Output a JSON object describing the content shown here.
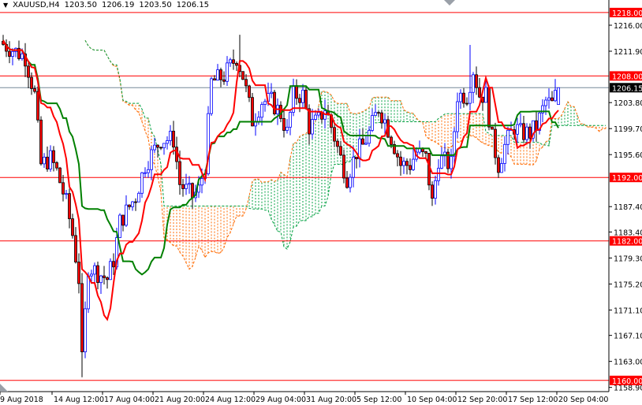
{
  "header": {
    "symbol": "XAUUSD,H4",
    "open": "1203.50",
    "high": "1206.19",
    "low": "1203.50",
    "close": "1206.15"
  },
  "colors": {
    "bull": "#0000ff",
    "bear": "#ff0000",
    "tenkan": "#ff0000",
    "kijun": "#008000",
    "cloud_bear": "#ff6a00",
    "cloud_bull": "#00a040",
    "level": "#ff0000",
    "price_line": "#778899"
  },
  "chart_data": {
    "type": "candlestick",
    "title": "XAUUSD,H4",
    "indicator": "Ichimoku Kinko Hyo (tenkan 9, kijun 26, senkou B 52)",
    "ylim": [
      1158.9,
      1218.0
    ],
    "y_ticks": [
      "1216.00",
      "1211.90",
      "1203.80",
      "1199.70",
      "1195.60",
      "1187.40",
      "1183.40",
      "1179.30",
      "1175.20",
      "1171.10",
      "1167.10",
      "1163.00",
      "1158.90"
    ],
    "y_tick_values": [
      1216.0,
      1211.9,
      1203.8,
      1199.7,
      1195.6,
      1187.4,
      1183.4,
      1179.3,
      1175.2,
      1171.1,
      1167.1,
      1163.0,
      1158.9
    ],
    "x_ticks": [
      "9 Aug 2018",
      "14 Aug 12:00",
      "17 Aug 04:00",
      "21 Aug 20:00",
      "24 Aug 12:00",
      "29 Aug 04:00",
      "31 Aug 20:00",
      "5 Sep 12:00",
      "10 Sep 04:00",
      "12 Sep 20:00",
      "17 Sep 12:00",
      "20 Sep 04:00"
    ],
    "bars_per_x_tick": 16,
    "levels": [
      {
        "value": 1218.0,
        "label": "1218.00"
      },
      {
        "value": 1208.0,
        "label": "1208.00"
      },
      {
        "value": 1192.0,
        "label": "1192.00"
      },
      {
        "value": 1182.0,
        "label": "1182.00"
      },
      {
        "value": 1160.0,
        "label": "1160.00"
      }
    ],
    "current_price": {
      "value": 1206.15,
      "label": "1206.15"
    },
    "close_path": [
      [
        0,
        1213
      ],
      [
        7,
        1211
      ],
      [
        10,
        1205
      ],
      [
        12,
        1194
      ],
      [
        15,
        1195
      ],
      [
        17,
        1193
      ],
      [
        20,
        1188
      ],
      [
        22,
        1183
      ],
      [
        24,
        1176
      ],
      [
        25,
        1163
      ],
      [
        27,
        1178
      ],
      [
        30,
        1177
      ],
      [
        33,
        1176
      ],
      [
        35,
        1179
      ],
      [
        37,
        1185
      ],
      [
        42,
        1189
      ],
      [
        45,
        1194
      ],
      [
        50,
        1198
      ],
      [
        54,
        1198
      ],
      [
        56,
        1191
      ],
      [
        60,
        1189
      ],
      [
        62,
        1190
      ],
      [
        64,
        1194
      ],
      [
        66,
        1207
      ],
      [
        70,
        1208
      ],
      [
        74,
        1211
      ],
      [
        76,
        1208
      ],
      [
        79,
        1201
      ],
      [
        82,
        1204
      ],
      [
        85,
        1204
      ],
      [
        88,
        1202
      ],
      [
        90,
        1199
      ],
      [
        92,
        1205
      ],
      [
        95,
        1205
      ],
      [
        97,
        1200
      ],
      [
        100,
        1201
      ],
      [
        102,
        1203
      ],
      [
        104,
        1200
      ],
      [
        107,
        1195
      ],
      [
        109,
        1192
      ],
      [
        112,
        1196
      ],
      [
        114,
        1197
      ],
      [
        116,
        1199
      ],
      [
        119,
        1203
      ],
      [
        121,
        1201
      ],
      [
        124,
        1197
      ],
      [
        126,
        1194
      ],
      [
        129,
        1194
      ],
      [
        131,
        1196
      ],
      [
        134,
        1195
      ],
      [
        136,
        1188
      ],
      [
        138,
        1195
      ],
      [
        142,
        1194
      ],
      [
        144,
        1205
      ],
      [
        147,
        1205
      ],
      [
        149,
        1209
      ],
      [
        151,
        1205
      ],
      [
        153,
        1205
      ],
      [
        155,
        1198
      ],
      [
        157,
        1194
      ],
      [
        159,
        1197
      ],
      [
        162,
        1200
      ],
      [
        164,
        1199
      ],
      [
        167,
        1199
      ],
      [
        169,
        1200
      ],
      [
        172,
        1204
      ],
      [
        174,
        1203.5
      ],
      [
        176,
        1206.15
      ]
    ],
    "spikes": [
      {
        "bar": 25,
        "low": 1160.5
      },
      {
        "bar": 75,
        "high": 1214.5
      },
      {
        "bar": 148,
        "high": 1212.9
      },
      {
        "bar": 136,
        "low": 1187.5
      }
    ]
  }
}
